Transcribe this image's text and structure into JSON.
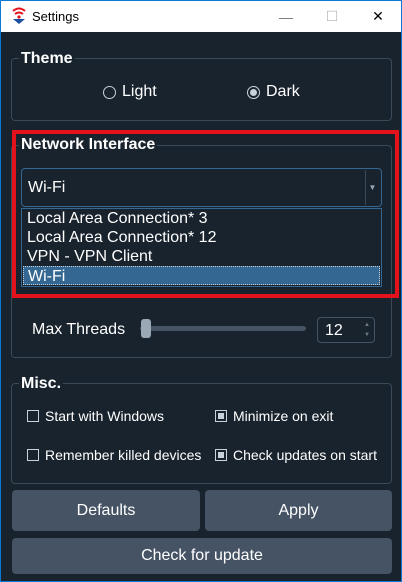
{
  "window": {
    "title": "Settings",
    "minimize_icon": "—",
    "maximize_icon": "☐",
    "close_icon": "✕"
  },
  "theme": {
    "title": "Theme",
    "options": [
      {
        "label": "Light",
        "checked": false
      },
      {
        "label": "Dark",
        "checked": true
      }
    ]
  },
  "network": {
    "title": "Network Interface",
    "selected": "Wi-Fi",
    "options": [
      "Local Area Connection* 3",
      "Local Area Connection* 12",
      "VPN - VPN Client",
      "Wi-Fi"
    ]
  },
  "performance": {
    "max_threads_label": "Max Threads",
    "max_threads_value": "12"
  },
  "misc": {
    "title": "Misc.",
    "options": [
      {
        "label": "Start with Windows",
        "checked": false
      },
      {
        "label": "Minimize on exit",
        "checked": true
      },
      {
        "label": "Remember killed devices",
        "checked": false
      },
      {
        "label": "Check updates on start",
        "checked": true
      }
    ]
  },
  "buttons": {
    "defaults": "Defaults",
    "apply": "Apply",
    "check_update": "Check for update"
  },
  "colors": {
    "accent": "#346792",
    "highlight": "#e3121b",
    "background": "#19232d",
    "button": "#455364"
  }
}
